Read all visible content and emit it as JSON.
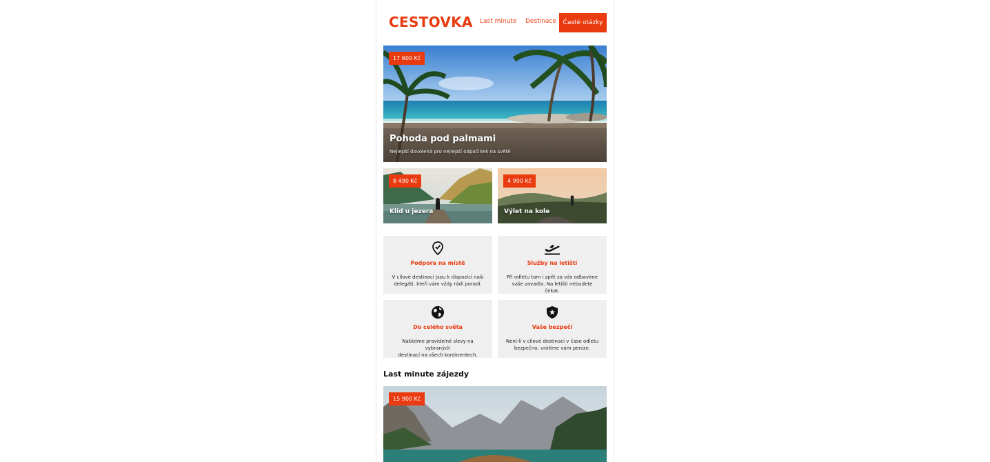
{
  "header": {
    "logo": "CESTOVKA",
    "nav": {
      "last_minute": "Last minute",
      "destinations": "Destinace",
      "faq": "Časté otázky"
    }
  },
  "hero": {
    "price": "17 600 Kč",
    "title": "Pohoda pod palmami",
    "subtitle": "Nejlepší dovolená pro nejlepší odpočinek na světě"
  },
  "cards": [
    {
      "price": "8 490 Kč",
      "title": "Klid u jezera"
    },
    {
      "price": "4 990 Kč",
      "title": "Výlet na kole"
    }
  ],
  "features": [
    {
      "icon": "location-check-icon",
      "title": "Podpora na místě",
      "line1": "V cílové destinaci jsou k dispozici naši",
      "line2": "delegáti, kteří vám vždy rádi poradí."
    },
    {
      "icon": "airplane-takeoff-icon",
      "title": "Služby na letišti",
      "line1": "Při odletu tam i zpět za vás odbavíme",
      "line2": "vaše zavadla. Na letišti nebudete čekat."
    },
    {
      "icon": "globe-icon",
      "title": "Do celého světa",
      "line1": "Nabízíme pravidelné slevy na vybraných",
      "line2": "destinací na všech kontinentech."
    },
    {
      "icon": "shield-icon",
      "title": "Vaše bezpečí",
      "line1": "Není-li v cílové destinaci v čase odletu",
      "line2": "bezpečno, vrátíme vám peníze."
    }
  ],
  "last_minute": {
    "heading": "Last minute zájezdy",
    "price": "15 900 Kč"
  },
  "colors": {
    "accent": "#ea3a0f",
    "feature_bg": "#efefef"
  }
}
